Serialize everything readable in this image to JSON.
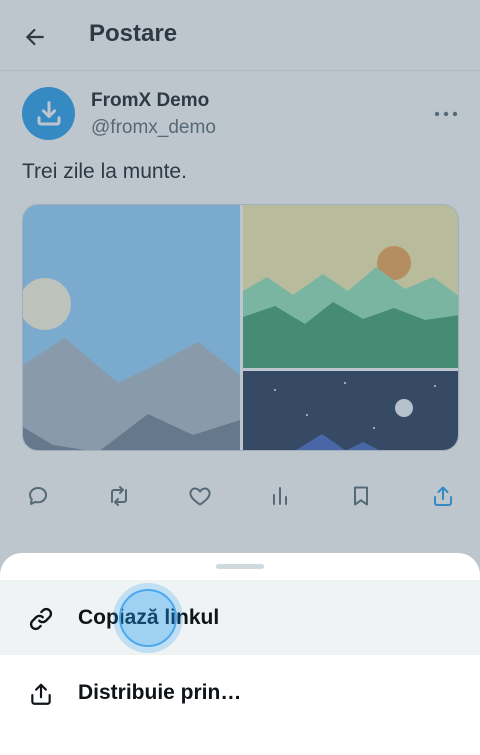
{
  "header": {
    "title": "Postare",
    "back_icon": "arrow-left-icon"
  },
  "post": {
    "author": {
      "name": "FromX Demo",
      "handle": "@fromx_demo",
      "avatar_icon": "download-icon",
      "avatar_color": "#1d9bf0"
    },
    "text": "Trei zile la munte.",
    "media": [
      {
        "kind": "illustration",
        "subject": "mountains-daylight"
      },
      {
        "kind": "illustration",
        "subject": "green-hills-sunset"
      },
      {
        "kind": "illustration",
        "subject": "mountains-night"
      }
    ],
    "actions": [
      {
        "icon": "reply-icon"
      },
      {
        "icon": "repost-icon"
      },
      {
        "icon": "like-icon"
      },
      {
        "icon": "views-icon"
      },
      {
        "icon": "bookmark-icon"
      },
      {
        "icon": "share-icon",
        "active": true
      }
    ]
  },
  "share_sheet": {
    "items": [
      {
        "label": "Copiază linkul",
        "icon": "link-icon",
        "pressed": true
      },
      {
        "label": "Distribuie prin…",
        "icon": "share-icon"
      }
    ]
  },
  "colors": {
    "accent": "#1d9bf0",
    "text_primary": "#0f1419",
    "text_secondary": "#536471",
    "scrim": "rgba(91,112,131,0.4)"
  }
}
